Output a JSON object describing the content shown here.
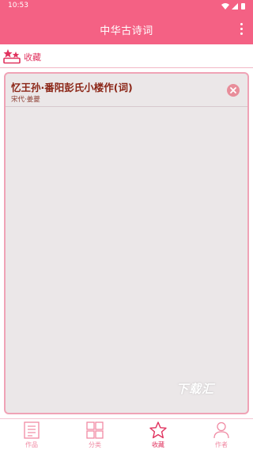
{
  "status_bar": {
    "time": "10:53"
  },
  "app_bar": {
    "title": "中华古诗词"
  },
  "section": {
    "title": "收藏"
  },
  "favorites": [
    {
      "title": "忆王孙·番阳彭氏小楼作(词)",
      "author": "宋代·姜夔"
    }
  ],
  "watermark": "下载汇",
  "bottom_nav": [
    {
      "label": "作品",
      "icon": "document-icon"
    },
    {
      "label": "分类",
      "icon": "grid-icon"
    },
    {
      "label": "收藏",
      "icon": "star-icon",
      "active": true
    },
    {
      "label": "作者",
      "icon": "person-icon"
    }
  ],
  "colors": {
    "primary": "#f46184",
    "accent": "#e0325e",
    "panel_bg": "#ebe7e8",
    "panel_border": "#f0a3b6",
    "title_text": "#8b2516"
  }
}
